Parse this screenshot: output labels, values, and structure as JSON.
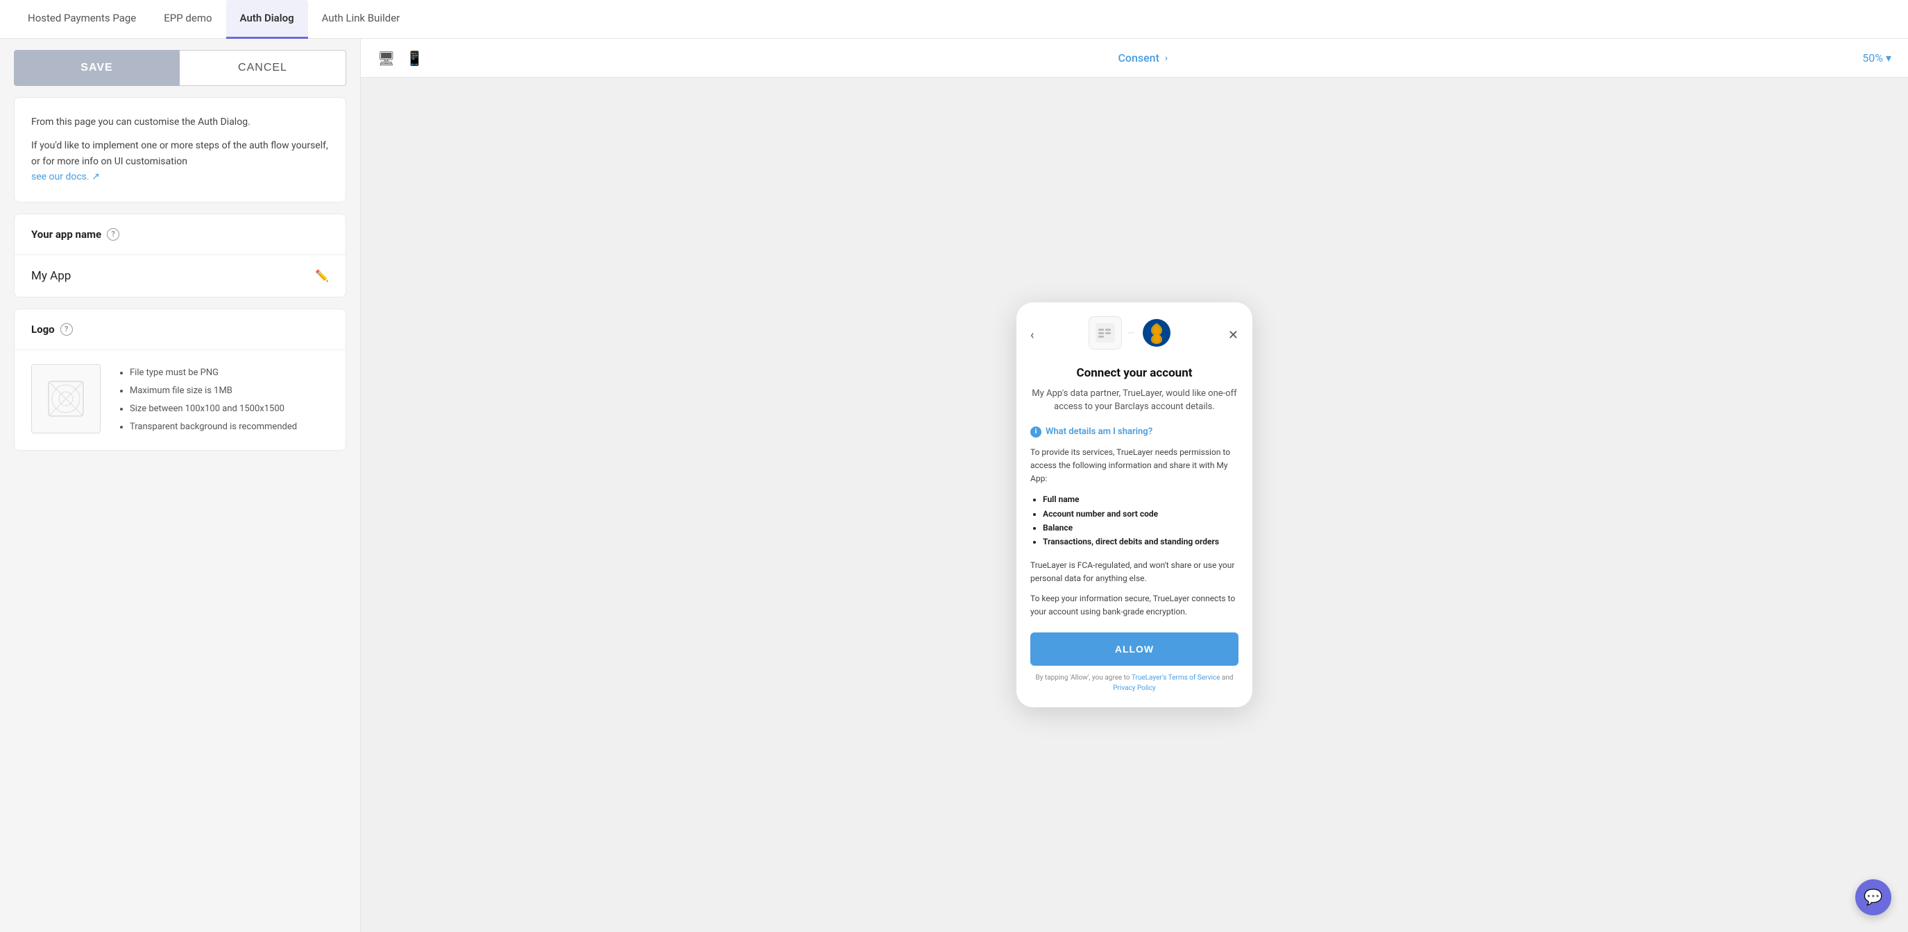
{
  "tabs": [
    {
      "id": "hosted-payments",
      "label": "Hosted Payments Page",
      "active": false
    },
    {
      "id": "epp-demo",
      "label": "EPP demo",
      "active": false
    },
    {
      "id": "auth-dialog",
      "label": "Auth Dialog",
      "active": true
    },
    {
      "id": "auth-link-builder",
      "label": "Auth Link Builder",
      "active": false
    }
  ],
  "toolbar": {
    "save_label": "SAVE",
    "cancel_label": "CANCEL"
  },
  "info_card": {
    "line1": "From this page you can customise the Auth Dialog.",
    "line2": "If you'd like to implement one or more steps of the auth flow yourself, or for more info on UI customisation",
    "link_text": "see our docs. ↗"
  },
  "app_name_section": {
    "header": "Your app name",
    "value": "My App"
  },
  "logo_section": {
    "header": "Logo",
    "instructions": [
      "File type must be PNG",
      "Maximum file size is 1MB",
      "Size between 100x100 and 1500x1500",
      "Transparent background is recommended"
    ]
  },
  "preview": {
    "label": "Consent",
    "zoom": "50%"
  },
  "dialog": {
    "title": "Connect your account",
    "subtitle": "My App's data partner, TrueLayer, would like one-off access to your Barclays account details.",
    "what_sharing_label": "What details am I sharing?",
    "sharing_desc": "To provide its services, TrueLayer needs permission to access the following information and share it with My App:",
    "sharing_items": [
      "Full name",
      "Account number and sort code",
      "Balance",
      "Transactions, direct debits and standing orders"
    ],
    "fca_text": "TrueLayer is FCA-regulated, and won't share or use your personal data for anything else.",
    "encryption_text": "To keep your information secure, TrueLayer connects to your account using bank-grade encryption.",
    "allow_label": "ALLOW",
    "terms_prefix": "By tapping 'Allow', you agree to ",
    "terms_link1": "TrueLayer's Terms of Service",
    "terms_and": " and ",
    "terms_link2": "Privacy Policy"
  }
}
